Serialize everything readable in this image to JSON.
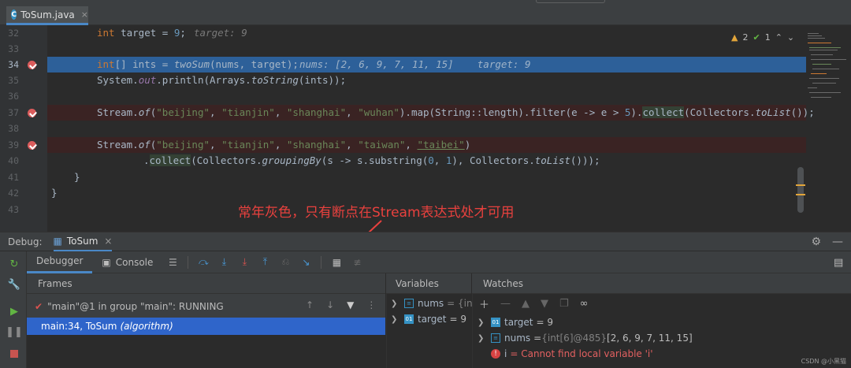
{
  "tab": {
    "title": "ToSum.java",
    "close": "×"
  },
  "inspection": {
    "warnings": "2",
    "ok": "1"
  },
  "editor": {
    "lines": [
      {
        "num": "32",
        "inline": "target: 9"
      },
      {
        "num": "33"
      },
      {
        "num": "34",
        "inline": "nums: [2, 6, 9, 7, 11, 15]    target: 9"
      },
      {
        "num": "35"
      },
      {
        "num": "36"
      },
      {
        "num": "37"
      },
      {
        "num": "38"
      },
      {
        "num": "39"
      },
      {
        "num": "40"
      },
      {
        "num": "41"
      },
      {
        "num": "42"
      },
      {
        "num": "43"
      }
    ]
  },
  "annotation": "常年灰色，只有断点在Stream表达式处才可用",
  "debug": {
    "label": "Debug:",
    "session": "ToSum",
    "session_close": "×",
    "tabs": {
      "debugger": "Debugger",
      "console": "Console"
    }
  },
  "frames": {
    "header": "Frames",
    "thread": "\"main\"@1 in group \"main\": RUNNING",
    "selected_frame": "main:34, ToSum",
    "selected_frame_pkg": "(algorithm)"
  },
  "variables": {
    "header": "Variables",
    "items": [
      {
        "name": "nums",
        "value": "= {int["
      },
      {
        "name": "target",
        "value": "= 9"
      }
    ]
  },
  "watches": {
    "header": "Watches",
    "items": [
      {
        "name": "target",
        "value": "= 9",
        "addr": "",
        "rest": ""
      },
      {
        "name": "nums",
        "value": "= ",
        "addr": "{int[6]@485}",
        "rest": " [2, 6, 9, 7, 11, 15]"
      },
      {
        "name": "i",
        "value": "= Cannot find local variable 'i'"
      }
    ]
  },
  "watermark": "CSDN @小黑猫",
  "colors": {
    "accent": "#4a88c7",
    "selection": "#2f65ca",
    "current_line": "#2d6099",
    "annotation": "#e9413e"
  }
}
